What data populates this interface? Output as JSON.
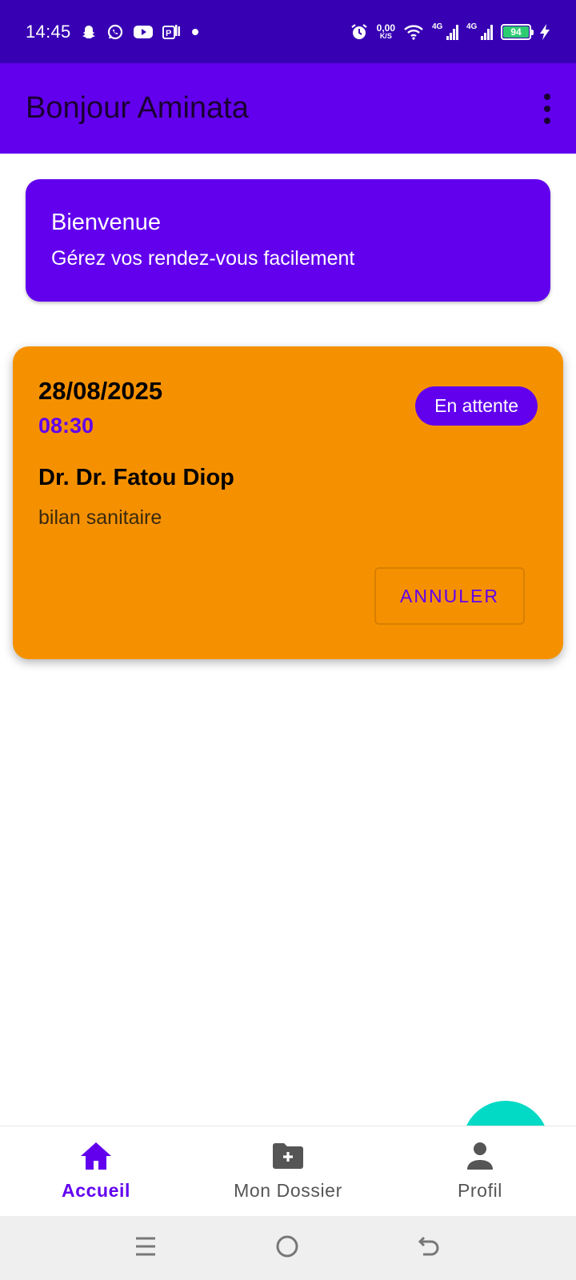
{
  "status_bar": {
    "time": "14:45",
    "left_icons": [
      "snapchat-icon",
      "whatsapp-icon",
      "youtube-icon",
      "parking-icon",
      "dot-icon"
    ],
    "net_speed_value": "0,00",
    "net_speed_unit": "K/S",
    "signal1_label": "4G",
    "signal2_label": "4G",
    "battery_level": "94",
    "colors": {
      "background": "#3700b3",
      "battery": "#2ecc71"
    }
  },
  "app_bar": {
    "title": "Bonjour Aminata",
    "menu_icon": "overflow-menu-icon",
    "background": "#6200ee"
  },
  "welcome_card": {
    "title": "Bienvenue",
    "subtitle": "Gérez vos rendez-vous facilement"
  },
  "appointments": [
    {
      "date": "28/08/2025",
      "time": "08:30",
      "status": "En attente",
      "doctor": "Dr. Dr. Fatou Diop",
      "reason": "bilan sanitaire",
      "cancel_label": "ANNULER",
      "card_color": "#f59100"
    }
  ],
  "bottom_nav": {
    "items": [
      {
        "label": "Accueil",
        "icon": "home-icon",
        "active": true
      },
      {
        "label": "Mon Dossier",
        "icon": "folder-add-icon",
        "active": false
      },
      {
        "label": "Profil",
        "icon": "person-icon",
        "active": false
      }
    ],
    "active_color": "#6200ee"
  },
  "system_nav": {
    "icons": [
      "recents-icon",
      "home-circle-icon",
      "back-icon"
    ]
  },
  "fab": {
    "color": "#03dac5"
  }
}
